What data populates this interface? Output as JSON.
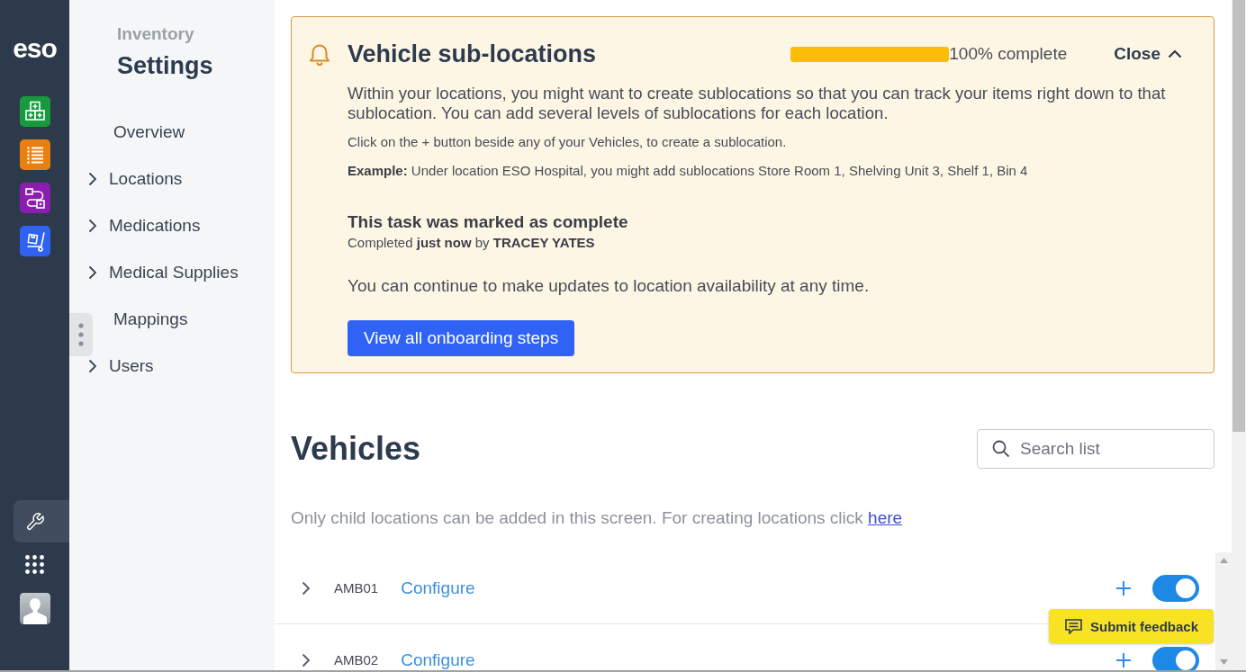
{
  "rail": {
    "logo": "eso",
    "apps": [
      {
        "kind": "boxes",
        "color": "#179a3d"
      },
      {
        "kind": "list",
        "color": "#e97f10"
      },
      {
        "kind": "flow",
        "color": "#8a1eae"
      },
      {
        "kind": "cart",
        "color": "#2f62f2"
      }
    ],
    "tools": [
      {
        "kind": "wrench",
        "selected": true
      },
      {
        "kind": "grid",
        "selected": false
      }
    ]
  },
  "sidebar": {
    "section": "Inventory",
    "title": "Settings",
    "items": [
      {
        "label": "Overview",
        "kind": "link"
      },
      {
        "label": "Locations",
        "kind": "group"
      },
      {
        "label": "Medications",
        "kind": "group"
      },
      {
        "label": "Medical Supplies",
        "kind": "group"
      },
      {
        "label": "Mappings",
        "kind": "link"
      },
      {
        "label": "Users",
        "kind": "group"
      }
    ]
  },
  "onboarding": {
    "title": "Vehicle sub-locations",
    "progress": {
      "level": 1,
      "reading": "100% complete"
    },
    "close": "Close",
    "expanded": true,
    "intro": "Within your locations, you might want to create sublocations so that you can track your items right down to that sublocation. You can add several levels of sublocations for each location.",
    "hint": "Click on the + button beside any of your Vehicles, to create a sublocation.",
    "example": "**Example:** Under location ESO Hospital, you might add sublocations Store Room 1, Shelving Unit 3, Shelf 1, Bin 4",
    "status_title": "This task was marked as complete",
    "status_detail": "Completed **just now** by **TRACEY YATES**",
    "note": "You can continue to make updates to location availability at any time.",
    "button": "View all onboarding steps"
  },
  "vehicles": {
    "title": "Vehicles",
    "search": {
      "placeholder": "Search list"
    },
    "info": "Only child locations can be added in this screen. For creating locations click",
    "info_link": "here",
    "rows": [
      {
        "name": "AMB01",
        "action": "Configure",
        "expanded": false,
        "on": true
      },
      {
        "name": "AMB02",
        "action": "Configure",
        "expanded": false,
        "on": true
      }
    ]
  },
  "feedback": {
    "label": "Submit feedback"
  }
}
